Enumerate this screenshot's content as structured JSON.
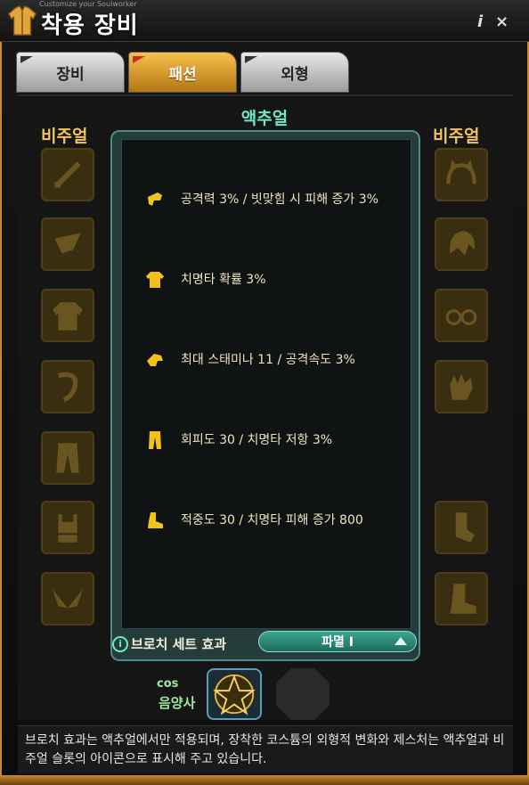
{
  "window": {
    "subtitle": "Customize your Soulworker",
    "title": "착용 장비",
    "info_label": "i",
    "close_label": "×"
  },
  "tabs": [
    {
      "label": "장비",
      "active": false
    },
    {
      "label": "패션",
      "active": true
    },
    {
      "label": "외형",
      "active": false
    }
  ],
  "left_column": {
    "label": "비주얼"
  },
  "right_column": {
    "label": "비주얼"
  },
  "center_title": "액추얼",
  "effects": [
    {
      "icon": "weapon-icon",
      "text": "공격력 3% / 빗맞힘 시 피해 증가 3%"
    },
    {
      "icon": "top-icon",
      "text": "치명타 확률 3%"
    },
    {
      "icon": "gloves-icon",
      "text": "최대 스태미나 11 / 공격속도 3%"
    },
    {
      "icon": "pants-icon",
      "text": "회피도 30 / 치명타 저항 3%"
    },
    {
      "icon": "shoes-icon",
      "text": "적중도 30 / 치명타 피해 증가 800"
    }
  ],
  "brooch": {
    "info_icon": "info-icon",
    "label": "브로치 세트 효과"
  },
  "set_select": {
    "value": "파멸 I"
  },
  "character": {
    "cos_label": "cos",
    "job_label": "음양사"
  },
  "description": "브로치 효과는 액추얼에서만 적용되며, 장착한 코스튬의 외형적 변화와 제스처는 액추얼과 비주얼 슬롯의 아이콘으로 표시해 주고 있습니다.",
  "colors": {
    "accent": "#f2c45a",
    "teal": "#6ee8c6",
    "tab_active": "#e0a030"
  }
}
